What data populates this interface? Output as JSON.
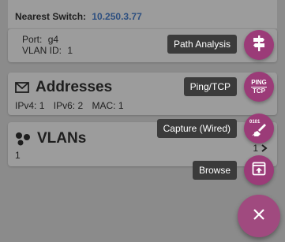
{
  "nearest_switch": {
    "label": "Nearest Switch:",
    "ip": "10.250.3.77",
    "port_label": "Port:",
    "port_value": "g4",
    "vlan_id_label": "VLAN ID:",
    "vlan_id_value": "1"
  },
  "addresses": {
    "title": "Addresses",
    "ipv4_label": "IPv4:",
    "ipv4_value": "1",
    "ipv6_label": "IPv6:",
    "ipv6_value": "2",
    "mac_label": "MAC:",
    "mac_value": "1"
  },
  "vlans": {
    "title": "VLANs",
    "sub_value": "1",
    "count": "1"
  },
  "fab_menu": {
    "path_analysis": "Path Analysis",
    "ping_tcp": "Ping/TCP",
    "capture_wired": "Capture (Wired)",
    "browse": "Browse",
    "ping_icon_top": "PING",
    "ping_icon_bottom": "TCP",
    "capture_icon_text": "0101"
  },
  "colors": {
    "background": "#8b8b8b",
    "card": "#9c9c9c",
    "accent_fab": "#9b3b78",
    "ip_text": "#2d4f80",
    "label_bg": "#3b3b3b"
  },
  "icons": {
    "addresses": "envelope-icon",
    "vlans": "network-nodes-icon",
    "path_analysis": "signpost-icon",
    "ping_tcp": "ping-tcp-icon",
    "capture": "capture-binary-icon",
    "browse": "browse-upload-icon",
    "close": "close-icon",
    "chevron": "chevron-right-icon"
  }
}
